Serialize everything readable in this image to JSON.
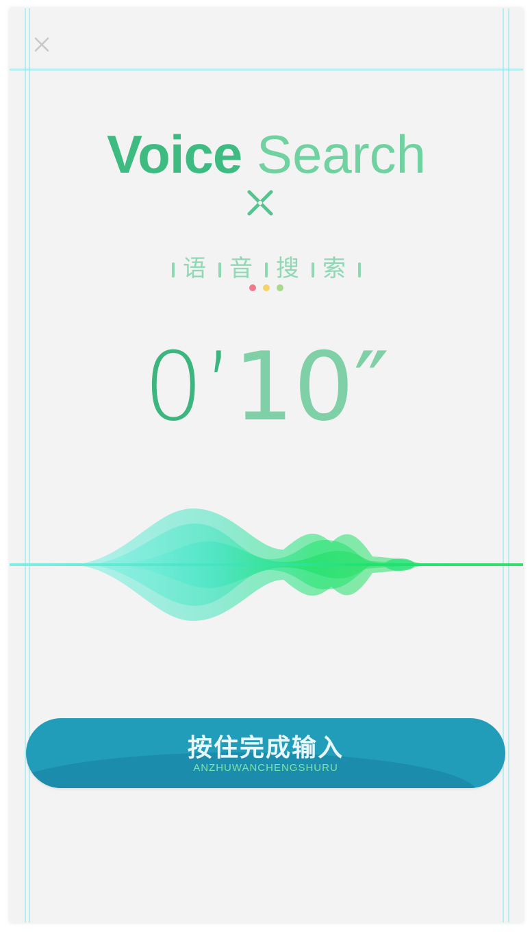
{
  "header": {
    "close_icon": "close-icon"
  },
  "hero": {
    "title_bold": "Voice",
    "title_light": "Search",
    "divider_icon": "cross-icon",
    "subtitle_chars": [
      "语",
      "音",
      "搜",
      "索"
    ],
    "indicator_colors": [
      "#f07a8a",
      "#f5d36a",
      "#a9d98a"
    ]
  },
  "timer": {
    "minutes": "0’",
    "seconds": "10",
    "seconds_mark": "″"
  },
  "waveform": {
    "icon": "voice-waveform",
    "colors": [
      "#4fe6c8",
      "#1ee26f"
    ]
  },
  "finish_button": {
    "label": "按住完成输入",
    "sub_label": "ANZHUWANCHENGSHURU"
  },
  "colors": {
    "accent_green": "#3dbb80",
    "button_blue": "#219db9"
  }
}
